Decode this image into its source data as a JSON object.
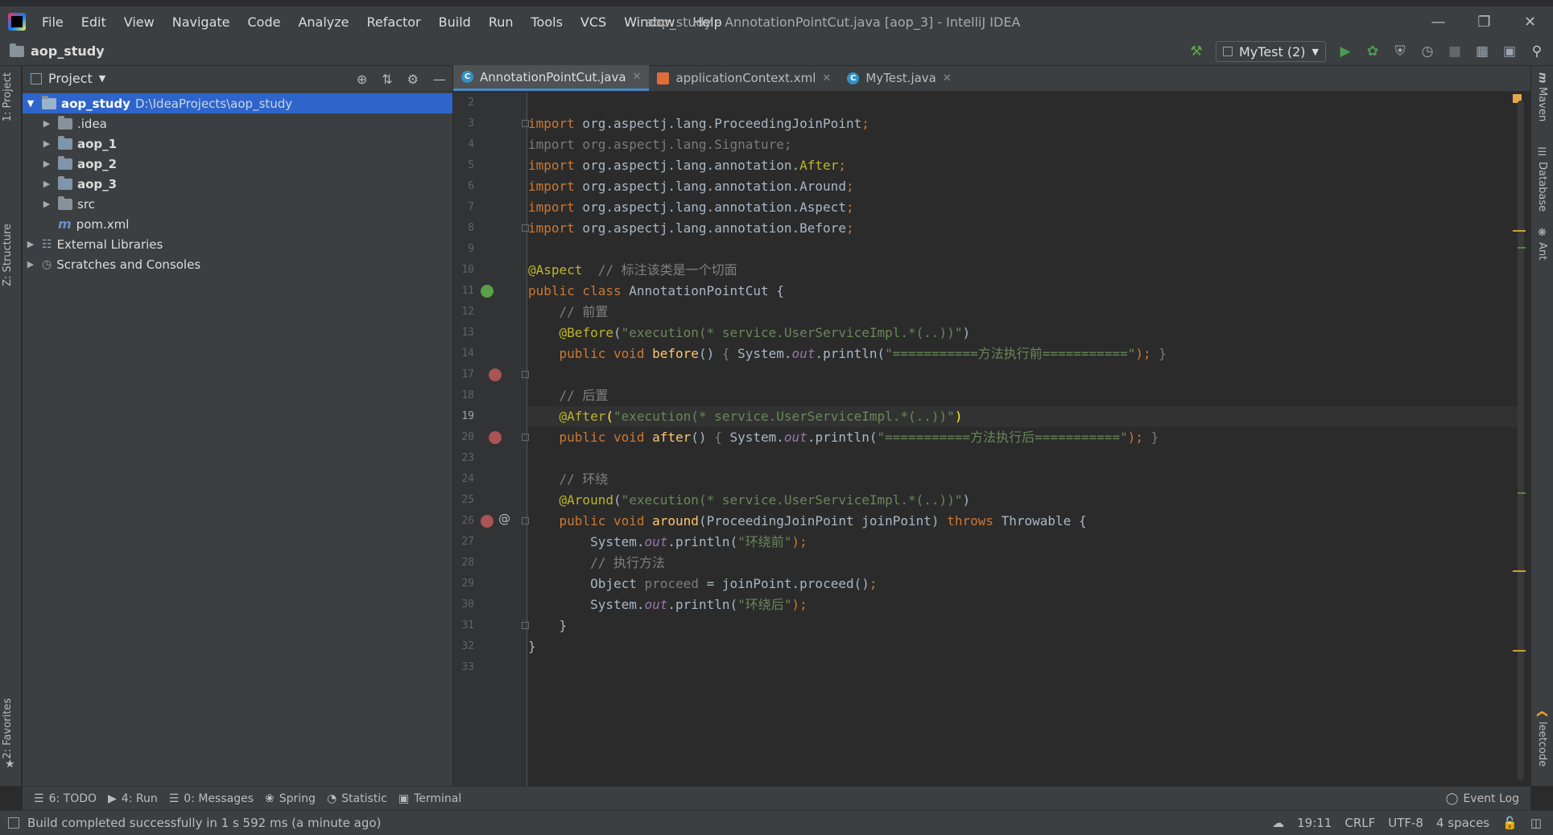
{
  "title_bar": {
    "menu": [
      "File",
      "Edit",
      "View",
      "Navigate",
      "Code",
      "Analyze",
      "Refactor",
      "Build",
      "Run",
      "Tools",
      "VCS",
      "Window",
      "Help"
    ],
    "window_title": "aop_study - AnnotationPointCut.java [aop_3] - IntelliJ IDEA"
  },
  "navbar": {
    "project": "aop_study",
    "run_config": "MyTest (2)"
  },
  "left_strip": {
    "project_tab": "1: Project",
    "structure_tab": "Z: Structure",
    "favorites_tab": "2: Favorites"
  },
  "right_strip": {
    "maven": "Maven",
    "database": "Database",
    "ant": "Ant",
    "leetcode": "leetcode"
  },
  "project_panel": {
    "title": "Project",
    "tree": [
      {
        "label": "aop_study",
        "path": "D:\\IdeaProjects\\aop_study"
      },
      {
        "label": ".idea"
      },
      {
        "label": "aop_1"
      },
      {
        "label": "aop_2"
      },
      {
        "label": "aop_3"
      },
      {
        "label": "src"
      },
      {
        "label": "pom.xml"
      },
      {
        "label": "External Libraries"
      },
      {
        "label": "Scratches and Consoles"
      }
    ]
  },
  "editor": {
    "tabs": [
      "AnnotationPointCut.java",
      "applicationContext.xml",
      "MyTest.java"
    ],
    "line_numbers": [
      "2",
      "3",
      "4",
      "5",
      "6",
      "7",
      "8",
      "9",
      "10",
      "11",
      "12",
      "13",
      "14",
      "17",
      "18",
      "19",
      "20",
      "23",
      "24",
      "25",
      "26",
      "27",
      "28",
      "29",
      "30",
      "31",
      "32",
      "33"
    ],
    "code": {
      "l3": [
        "import",
        " org.aspectj.lang.ProceedingJoinPoint",
        ";"
      ],
      "l4": [
        "import org.aspectj.lang.Signature;"
      ],
      "l5": [
        "import",
        " org.aspectj.lang.annotation.",
        "After",
        ";"
      ],
      "l6": [
        "import",
        " org.aspectj.lang.annotation.Around",
        ";"
      ],
      "l7": [
        "import",
        " org.aspectj.lang.annotation.Aspect",
        ";"
      ],
      "l8": [
        "import",
        " org.aspectj.lang.annotation.Before",
        ";"
      ],
      "l10": [
        "@Aspect",
        "  // 标注该类是一个切面"
      ],
      "l11": [
        "public class",
        " AnnotationPointCut {"
      ],
      "l12": [
        "    // 前置"
      ],
      "l13": [
        "    @Before",
        "(",
        "\"execution(* service.UserServiceImpl.*(..))\"",
        ")"
      ],
      "l14": [
        "    public void",
        " before",
        "() ",
        "{",
        " System.",
        "out",
        ".println(",
        "\"===========方法执行前===========\"",
        ");",
        " }"
      ],
      "l18": [
        "    // 后置"
      ],
      "l19": [
        "    @After",
        "(",
        "\"execution(* service.UserServiceImpl.*(..))\"",
        ")"
      ],
      "l20": [
        "    public void",
        " after",
        "() ",
        "{",
        " System.",
        "out",
        ".println(",
        "\"===========方法执行后===========\"",
        ");",
        " }"
      ],
      "l24": [
        "    // 环绕"
      ],
      "l25": [
        "    @Around",
        "(",
        "\"execution(* service.UserServiceImpl.*(..))\"",
        ")"
      ],
      "l26": [
        "    public void",
        " around",
        "(ProceedingJoinPoint joinPoint) ",
        "throws",
        " Throwable {"
      ],
      "l27": [
        "        System.",
        "out",
        ".println(",
        "\"环绕前\"",
        ");"
      ],
      "l28": [
        "        // 执行方法"
      ],
      "l29": [
        "        Object ",
        "proceed",
        " = joinPoint.proceed()",
        ";"
      ],
      "l30": [
        "        System.",
        "out",
        ".println(",
        "\"环绕后\"",
        ");"
      ],
      "l31": [
        "    }"
      ],
      "l32": [
        "}"
      ]
    }
  },
  "bottom_tools": {
    "todo": "6: TODO",
    "run": "4: Run",
    "messages": "0: Messages",
    "spring": "Spring",
    "statistic": "Statistic",
    "terminal": "Terminal",
    "event_log": "Event Log"
  },
  "status_bar": {
    "message": "Build completed successfully in 1 s 592 ms (a minute ago)",
    "position": "19:11",
    "line_sep": "CRLF",
    "encoding": "UTF-8",
    "indent": "4 spaces"
  }
}
